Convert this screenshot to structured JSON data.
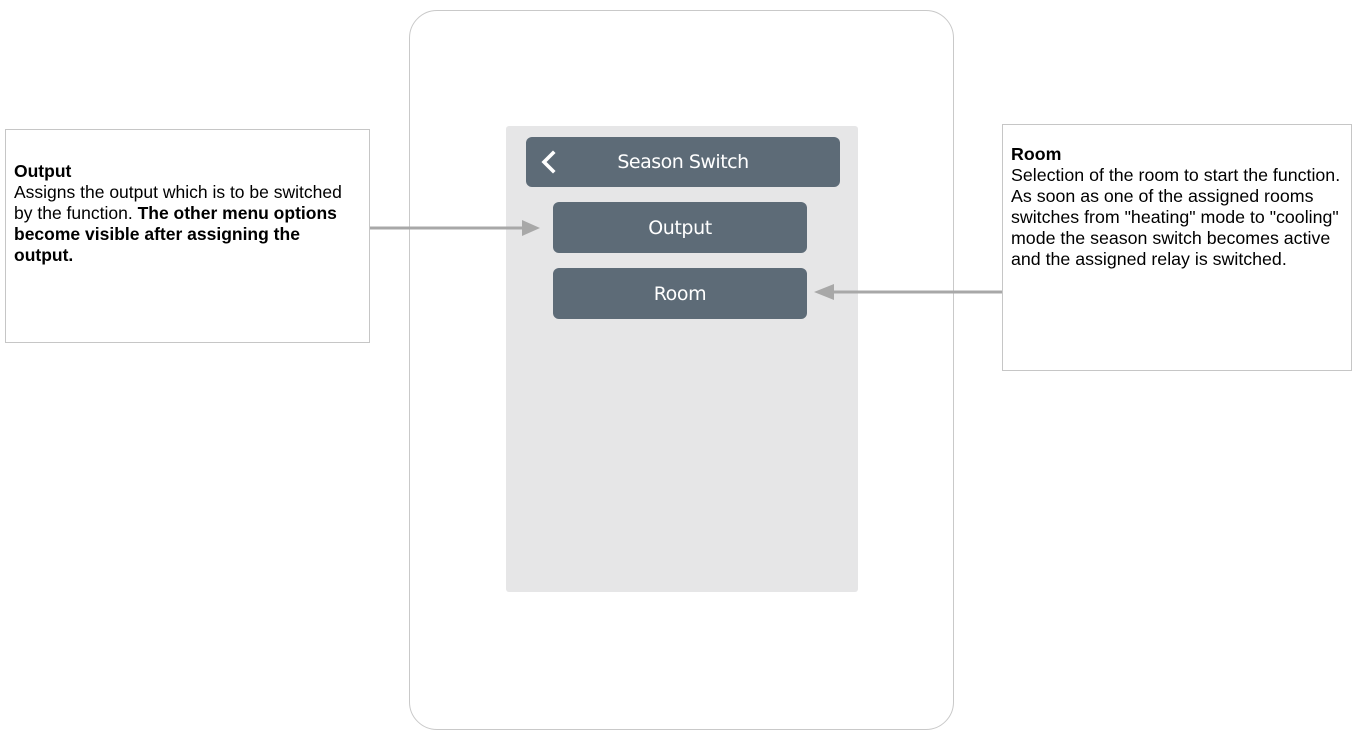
{
  "screen": {
    "title": "Season Switch",
    "back_icon": "chevron-left-icon",
    "menu_items": [
      {
        "label": "Output"
      },
      {
        "label": "Room"
      }
    ]
  },
  "callouts": {
    "output": {
      "title": "Output",
      "body_plain": "Assigns the output which is to be switched by the function. ",
      "body_bold": "The other menu options become visible after assigning the output."
    },
    "room": {
      "title": "Room",
      "body": "Selection of the room to start the function. As soon as one of the assigned rooms switches from \"heating\" mode to \"cooling\" mode the season switch becomes active and the assigned relay is switched."
    }
  },
  "colors": {
    "button_bg": "#5d6b77",
    "screen_bg": "#e6e6e7",
    "connector": "#a8a8a8"
  }
}
